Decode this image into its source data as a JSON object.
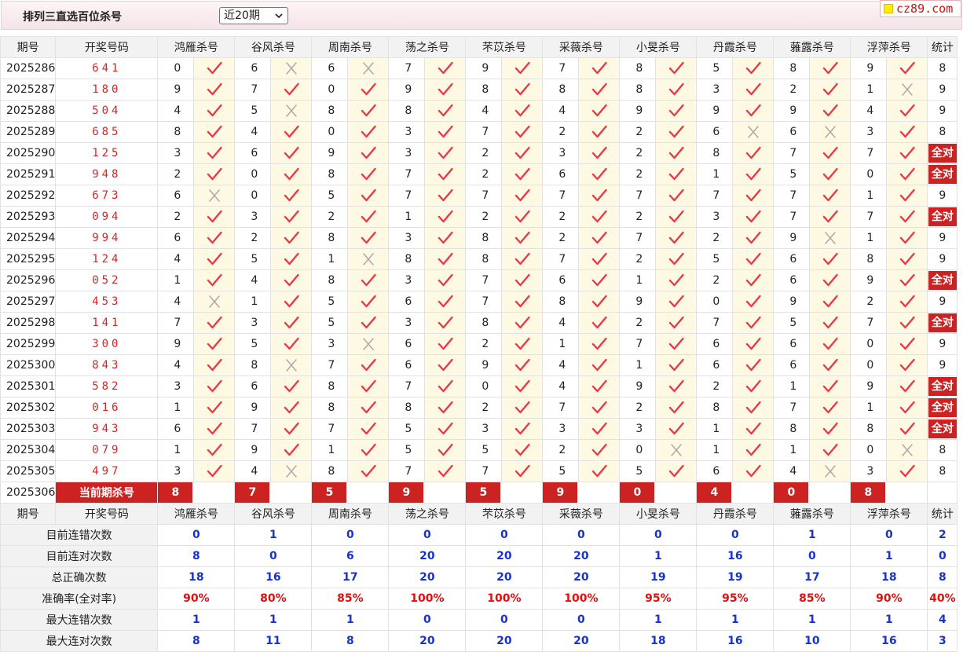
{
  "header": {
    "title": "排列三直选百位杀号",
    "select_value": "近20期",
    "watermark": "cz89.com"
  },
  "columns": {
    "issue": "期号",
    "draw": "开奖号码",
    "experts": [
      "鸿雁杀号",
      "谷风杀号",
      "周南杀号",
      "荡之杀号",
      "芣苡杀号",
      "采薇杀号",
      "小旻杀号",
      "丹霞杀号",
      "蕥露杀号",
      "浮萍杀号"
    ],
    "stat": "统计"
  },
  "rows": [
    {
      "issue": "2025286",
      "draw": "641",
      "kills": [
        0,
        6,
        6,
        7,
        9,
        7,
        8,
        5,
        8,
        9
      ],
      "ok": [
        1,
        0,
        0,
        1,
        1,
        1,
        1,
        1,
        1,
        1
      ],
      "stat": "8"
    },
    {
      "issue": "2025287",
      "draw": "180",
      "kills": [
        9,
        7,
        0,
        9,
        8,
        8,
        8,
        3,
        2,
        1
      ],
      "ok": [
        1,
        1,
        1,
        1,
        1,
        1,
        1,
        1,
        1,
        0
      ],
      "stat": "9"
    },
    {
      "issue": "2025288",
      "draw": "504",
      "kills": [
        4,
        5,
        8,
        8,
        4,
        4,
        9,
        9,
        9,
        4
      ],
      "ok": [
        1,
        0,
        1,
        1,
        1,
        1,
        1,
        1,
        1,
        1
      ],
      "stat": "9"
    },
    {
      "issue": "2025289",
      "draw": "685",
      "kills": [
        8,
        4,
        0,
        3,
        7,
        2,
        2,
        6,
        6,
        3
      ],
      "ok": [
        1,
        1,
        1,
        1,
        1,
        1,
        1,
        0,
        0,
        1
      ],
      "stat": "8"
    },
    {
      "issue": "2025290",
      "draw": "125",
      "kills": [
        3,
        6,
        9,
        3,
        2,
        3,
        2,
        8,
        7,
        7
      ],
      "ok": [
        1,
        1,
        1,
        1,
        1,
        1,
        1,
        1,
        1,
        1
      ],
      "stat": "全对"
    },
    {
      "issue": "2025291",
      "draw": "948",
      "kills": [
        2,
        0,
        8,
        7,
        2,
        6,
        2,
        1,
        5,
        0
      ],
      "ok": [
        1,
        1,
        1,
        1,
        1,
        1,
        1,
        1,
        1,
        1
      ],
      "stat": "全对"
    },
    {
      "issue": "2025292",
      "draw": "673",
      "kills": [
        6,
        0,
        5,
        7,
        7,
        7,
        7,
        7,
        7,
        1
      ],
      "ok": [
        0,
        1,
        1,
        1,
        1,
        1,
        1,
        1,
        1,
        1
      ],
      "stat": "9"
    },
    {
      "issue": "2025293",
      "draw": "094",
      "kills": [
        2,
        3,
        2,
        1,
        2,
        2,
        2,
        3,
        7,
        7
      ],
      "ok": [
        1,
        1,
        1,
        1,
        1,
        1,
        1,
        1,
        1,
        1
      ],
      "stat": "全对"
    },
    {
      "issue": "2025294",
      "draw": "994",
      "kills": [
        6,
        2,
        8,
        3,
        8,
        2,
        7,
        2,
        9,
        1
      ],
      "ok": [
        1,
        1,
        1,
        1,
        1,
        1,
        1,
        1,
        0,
        1
      ],
      "stat": "9"
    },
    {
      "issue": "2025295",
      "draw": "124",
      "kills": [
        4,
        5,
        1,
        8,
        8,
        7,
        2,
        5,
        6,
        8
      ],
      "ok": [
        1,
        1,
        0,
        1,
        1,
        1,
        1,
        1,
        1,
        1
      ],
      "stat": "9"
    },
    {
      "issue": "2025296",
      "draw": "052",
      "kills": [
        1,
        4,
        8,
        3,
        7,
        6,
        1,
        2,
        6,
        9
      ],
      "ok": [
        1,
        1,
        1,
        1,
        1,
        1,
        1,
        1,
        1,
        1
      ],
      "stat": "全对"
    },
    {
      "issue": "2025297",
      "draw": "453",
      "kills": [
        4,
        1,
        5,
        6,
        7,
        8,
        9,
        0,
        9,
        2
      ],
      "ok": [
        0,
        1,
        1,
        1,
        1,
        1,
        1,
        1,
        1,
        1
      ],
      "stat": "9"
    },
    {
      "issue": "2025298",
      "draw": "141",
      "kills": [
        7,
        3,
        5,
        3,
        8,
        4,
        2,
        7,
        5,
        7
      ],
      "ok": [
        1,
        1,
        1,
        1,
        1,
        1,
        1,
        1,
        1,
        1
      ],
      "stat": "全对"
    },
    {
      "issue": "2025299",
      "draw": "300",
      "kills": [
        9,
        5,
        3,
        6,
        2,
        1,
        7,
        6,
        6,
        0
      ],
      "ok": [
        1,
        1,
        0,
        1,
        1,
        1,
        1,
        1,
        1,
        1
      ],
      "stat": "9"
    },
    {
      "issue": "2025300",
      "draw": "843",
      "kills": [
        4,
        8,
        7,
        6,
        9,
        4,
        1,
        6,
        6,
        0
      ],
      "ok": [
        1,
        0,
        1,
        1,
        1,
        1,
        1,
        1,
        1,
        1
      ],
      "stat": "9"
    },
    {
      "issue": "2025301",
      "draw": "582",
      "kills": [
        3,
        6,
        8,
        7,
        0,
        4,
        9,
        2,
        1,
        9
      ],
      "ok": [
        1,
        1,
        1,
        1,
        1,
        1,
        1,
        1,
        1,
        1
      ],
      "stat": "全对"
    },
    {
      "issue": "2025302",
      "draw": "016",
      "kills": [
        1,
        9,
        8,
        8,
        2,
        7,
        2,
        8,
        7,
        1
      ],
      "ok": [
        1,
        1,
        1,
        1,
        1,
        1,
        1,
        1,
        1,
        1
      ],
      "stat": "全对"
    },
    {
      "issue": "2025303",
      "draw": "943",
      "kills": [
        6,
        7,
        7,
        5,
        3,
        3,
        3,
        1,
        8,
        8
      ],
      "ok": [
        1,
        1,
        1,
        1,
        1,
        1,
        1,
        1,
        1,
        1
      ],
      "stat": "全对"
    },
    {
      "issue": "2025304",
      "draw": "079",
      "kills": [
        1,
        9,
        1,
        5,
        5,
        2,
        0,
        1,
        1,
        0
      ],
      "ok": [
        1,
        1,
        1,
        1,
        1,
        1,
        0,
        1,
        1,
        0
      ],
      "stat": "8"
    },
    {
      "issue": "2025305",
      "draw": "497",
      "kills": [
        3,
        4,
        8,
        7,
        7,
        5,
        5,
        6,
        4,
        3
      ],
      "ok": [
        1,
        0,
        1,
        1,
        1,
        1,
        1,
        1,
        0,
        1
      ],
      "stat": "8"
    }
  ],
  "current": {
    "issue": "2025306",
    "label": "当前期杀号",
    "kills": [
      "8",
      "7",
      "5",
      "9",
      "5",
      "9",
      "0",
      "4",
      "0",
      "8"
    ]
  },
  "summary": [
    {
      "label": "目前连错次数",
      "values": [
        "0",
        "1",
        "0",
        "0",
        "0",
        "0",
        "0",
        "0",
        "1",
        "0"
      ],
      "stat": "2",
      "red": false
    },
    {
      "label": "目前连对次数",
      "values": [
        "8",
        "0",
        "6",
        "20",
        "20",
        "20",
        "1",
        "16",
        "0",
        "1"
      ],
      "stat": "0",
      "red": false
    },
    {
      "label": "总正确次数",
      "values": [
        "18",
        "16",
        "17",
        "20",
        "20",
        "20",
        "19",
        "19",
        "17",
        "18"
      ],
      "stat": "8",
      "red": false
    },
    {
      "label": "准确率(全对率)",
      "values": [
        "90%",
        "80%",
        "85%",
        "100%",
        "100%",
        "100%",
        "95%",
        "95%",
        "85%",
        "90%"
      ],
      "stat": "40%",
      "red": true
    },
    {
      "label": "最大连错次数",
      "values": [
        "1",
        "1",
        "1",
        "0",
        "0",
        "0",
        "1",
        "1",
        "1",
        "1"
      ],
      "stat": "4",
      "red": false
    },
    {
      "label": "最大连对次数",
      "values": [
        "8",
        "11",
        "8",
        "20",
        "20",
        "20",
        "18",
        "16",
        "10",
        "16"
      ],
      "stat": "3",
      "red": false
    }
  ],
  "icons": {
    "right": "check-icon",
    "wrong": "cross-icon"
  },
  "colors": {
    "accent": "#cc2222",
    "check": "#e8394a",
    "cross": "#aaaaaa",
    "blue": "#1733c9",
    "mark_bg": "#fdf9e3"
  }
}
